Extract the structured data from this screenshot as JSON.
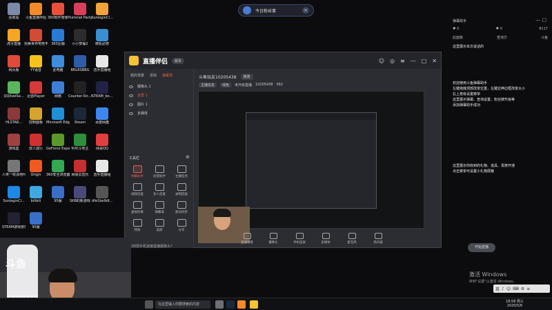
{
  "top_search": {
    "text": "今日粉丝事"
  },
  "desktop_icons": [
    {
      "label": "回收站",
      "color": "#7a8aa8"
    },
    {
      "label": "斗鱼直播伴侣",
      "color": "#f28a2a"
    },
    {
      "label": "360软件管家",
      "color": "#e94f3b"
    },
    {
      "label": "Pummel Party",
      "color": "#d93f59"
    },
    {
      "label": "SunloginCl...",
      "color": "#f2a33a"
    },
    {
      "label": "虎牙直播",
      "color": "#f5a623"
    },
    {
      "label": "完美世界电竞平台",
      "color": "#d24b35"
    },
    {
      "label": "360压缩",
      "color": "#2a7bd6"
    },
    {
      "label": "小小梦魇2",
      "color": "#2c2c2c"
    },
    {
      "label": "微机必修",
      "color": "#3a8fd3"
    },
    {
      "label": "网页版",
      "color": "#e04a3a"
    },
    {
      "label": "YY语音",
      "color": "#f4c21d"
    },
    {
      "label": "此电脑",
      "color": "#3c8dde"
    },
    {
      "label": "BRLRSBBG",
      "color": "#2d5da8"
    },
    {
      "label": "选手直播组",
      "color": "#e8e8e8"
    },
    {
      "label": "QQlivelSe...",
      "color": "#5ab55d"
    },
    {
      "label": "迅雷Player",
      "color": "#d43a3a"
    },
    {
      "label": "网络",
      "color": "#3c7fd4"
    },
    {
      "label": "Counter-Str...Global Off...",
      "color": "#222"
    },
    {
      "label": "STEAM_bo...",
      "color": "#224"
    },
    {
      "label": "HLSTAR...",
      "color": "#8a3a3a"
    },
    {
      "label": "控制面板",
      "color": "#d6a32e"
    },
    {
      "label": "Microsoft Edge",
      "color": "#1f8fd6"
    },
    {
      "label": "Steam",
      "color": "#1b2838"
    },
    {
      "label": "百度网盘",
      "color": "#3d86f0"
    },
    {
      "label": "游戏盒",
      "color": "#a04040"
    },
    {
      "label": "双人成行",
      "color": "#d03030"
    },
    {
      "label": "GeForce Experience",
      "color": "#5a9a2a"
    },
    {
      "label": "叭叭斗地主",
      "color": "#2d8f3a"
    },
    {
      "label": "网易QQ",
      "color": "#e43d3d"
    },
    {
      "label": "人类一败涂地Human: F...",
      "color": "#777"
    },
    {
      "label": "Origin",
      "color": "#f05a22"
    },
    {
      "label": "360安全浏览器",
      "color": "#34a853"
    },
    {
      "label": "网易云音乐",
      "color": "#c62f2f"
    },
    {
      "label": "选手直播组",
      "color": "#e8e8e8"
    },
    {
      "label": "SunloginCl...",
      "color": "#1e88e5"
    },
    {
      "label": "bilibili",
      "color": "#3da9e0"
    },
    {
      "label": "95服",
      "color": "#3a6fc8"
    },
    {
      "label": "SKB的新游戏",
      "color": "#4a4a7a"
    },
    {
      "label": "dfe1be9df...",
      "color": "#555"
    },
    {
      "label": "STEAM游戏管理",
      "color": "#223"
    },
    {
      "label": "95服",
      "color": "#3a6fc8"
    }
  ],
  "helper_panel": {
    "title": "弹幕助手",
    "minmax": "— □",
    "stats": [
      "♥ 0",
      "♥ 0",
      "8117"
    ],
    "tabs": [
      "此面板",
      "查询方",
      "斗鱼"
    ],
    "msg_top": "这里展示本次说话的",
    "welcome": [
      "欢迎使用斗鱼弹幕助手",
      "左键拖拽顶部改变位置，左键拉伸边框改变大小",
      "右上角有设置菜单",
      "这里展示弹幕、查询设置、粉丝牌升级等",
      "添加弹幕助手成功"
    ],
    "gift_msg": [
      "这里展示你收到的礼物、道具、贵族开通",
      "点击菜单可设置小礼物屏蔽"
    ]
  },
  "app": {
    "name": "直播伴侣",
    "version": "版本",
    "title_controls": [
      "☺",
      "◎",
      "≡",
      "—",
      "□"
    ],
    "close": "✕",
    "subtabs": [
      "我的场景",
      "添加",
      "弹幕源"
    ],
    "scenes": [
      "摄像头 1",
      "全屏 1",
      "图片 1",
      "多媒体"
    ],
    "tools_title": "工具栏",
    "tools_plus": "⊕",
    "tools": [
      "弹幕助手",
      "房管助手",
      "主播任务",
      "视频连麦",
      "多人连麦",
      "录制回放",
      "虚拟形象",
      "弹幕墙",
      "歌词同步",
      "特效",
      "美颜",
      "分享"
    ],
    "room_name": "斗鱼玩友10205438",
    "room_btn": "修改",
    "info_tags": [
      "主播信息",
      "绿色",
      "未开启直播",
      "10205438",
      "582"
    ],
    "controls": [
      "直播场景",
      "摄像头",
      "手机投屏",
      "多媒体",
      "麦克风",
      "扬声器"
    ],
    "live_button": "开始直播",
    "footer": "如何把手机连接直播摄像头？"
  },
  "streamer": {
    "logo": "斗鱼",
    "room_id": "10205438"
  },
  "activation": {
    "line1": "激活 Windows",
    "line2": "转到\"设置\"以激活 Windows。"
  },
  "ime": {
    "items": [
      "英",
      "♪",
      "☺",
      "⌨",
      "⚙",
      "≡"
    ]
  },
  "taskbar": {
    "search_placeholder": "在这里输入你要搜索的内容",
    "time": "18:58 周三",
    "date": "2020/5/6"
  }
}
